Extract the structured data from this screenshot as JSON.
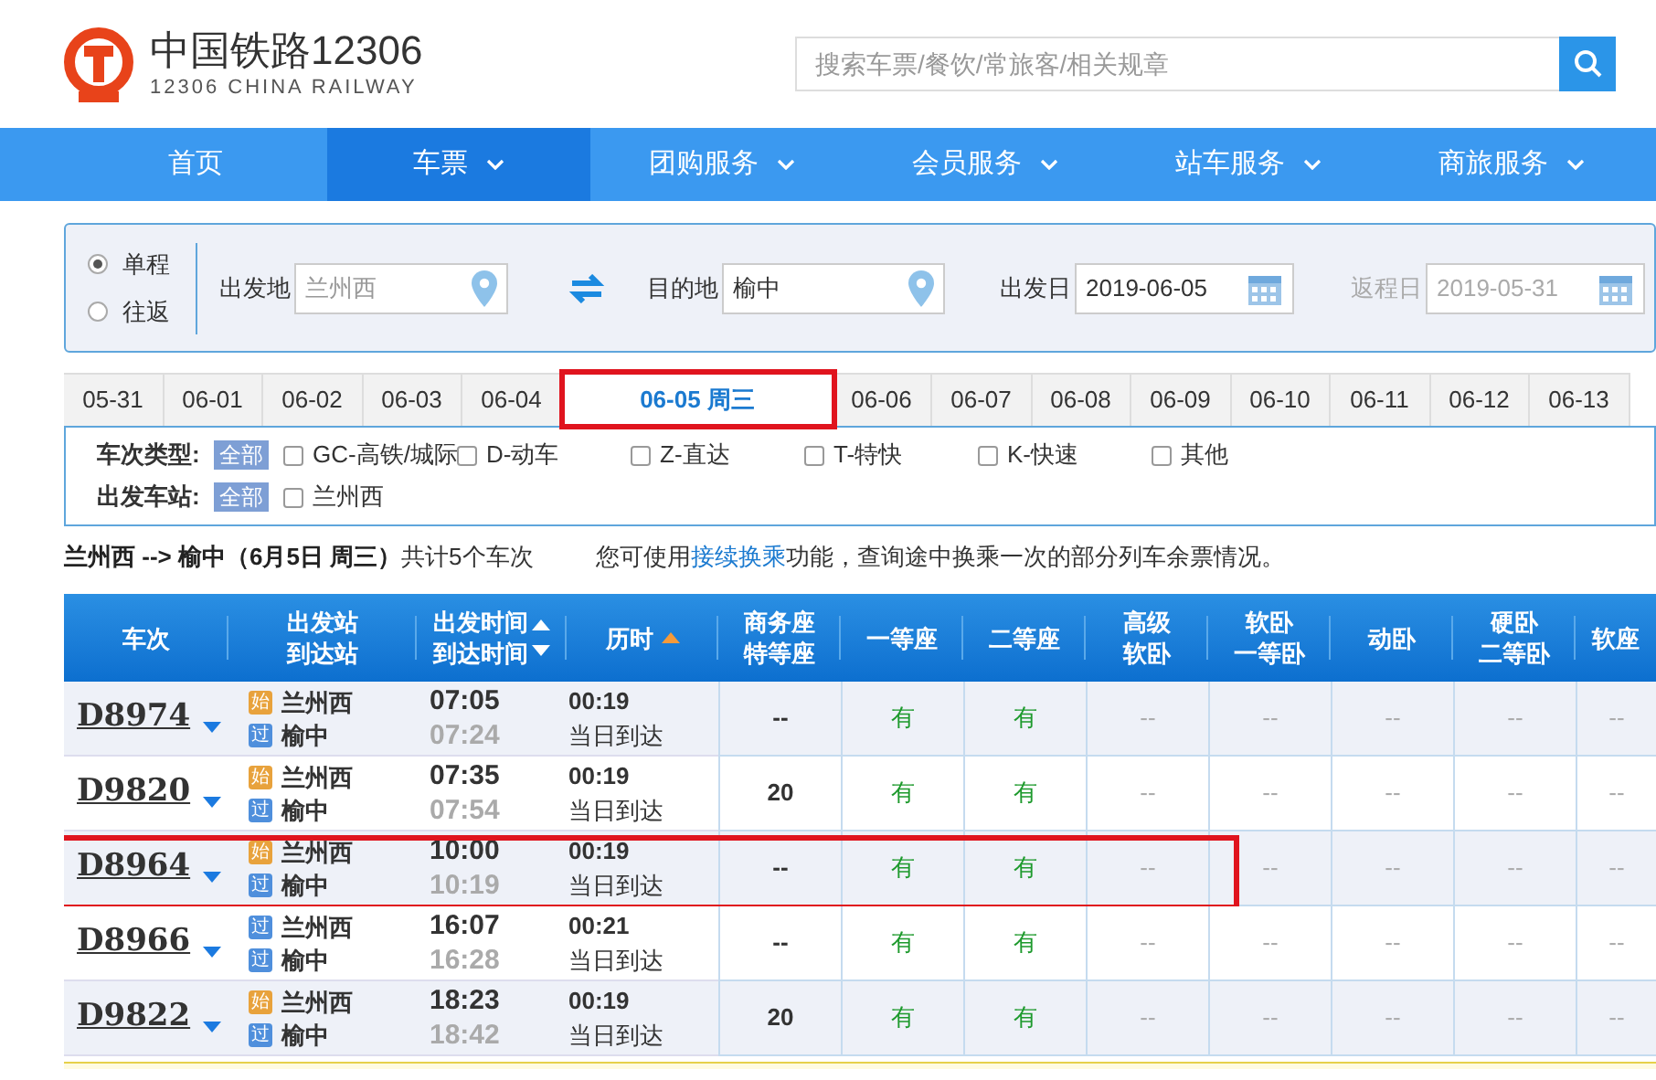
{
  "header": {
    "logo_title": "中国铁路12306",
    "logo_subtitle": "12306 CHINA RAILWAY",
    "search_placeholder": "搜索车票/餐饮/常旅客/相关规章"
  },
  "nav": [
    {
      "label": "首页",
      "selected": false,
      "dropdown": false
    },
    {
      "label": "车票",
      "selected": true,
      "dropdown": true
    },
    {
      "label": "团购服务",
      "selected": false,
      "dropdown": true
    },
    {
      "label": "会员服务",
      "selected": false,
      "dropdown": true
    },
    {
      "label": "站车服务",
      "selected": false,
      "dropdown": true
    },
    {
      "label": "商旅服务",
      "selected": false,
      "dropdown": true
    }
  ],
  "trip_type": [
    {
      "label": "单程",
      "selected": true
    },
    {
      "label": "往返",
      "selected": false
    }
  ],
  "query": {
    "from_label": "出发地",
    "from_value": "兰州西",
    "to_label": "目的地",
    "to_value": "榆中",
    "date_label": "出发日",
    "date_value": "2019-06-05",
    "return_label": "返程日",
    "return_value": "2019-05-31"
  },
  "date_tabs": [
    {
      "label": "05-31",
      "selected": false
    },
    {
      "label": "06-01",
      "selected": false
    },
    {
      "label": "06-02",
      "selected": false
    },
    {
      "label": "06-03",
      "selected": false
    },
    {
      "label": "06-04",
      "selected": false
    },
    {
      "label": "06-05 周三",
      "selected": true
    },
    {
      "label": "06-06",
      "selected": false
    },
    {
      "label": "06-07",
      "selected": false
    },
    {
      "label": "06-08",
      "selected": false
    },
    {
      "label": "06-09",
      "selected": false
    },
    {
      "label": "06-10",
      "selected": false
    },
    {
      "label": "06-11",
      "selected": false
    },
    {
      "label": "06-12",
      "selected": false
    },
    {
      "label": "06-13",
      "selected": false
    }
  ],
  "filters": [
    {
      "label": "车次类型:",
      "all": "全部",
      "options": [
        {
          "label": "GC-高铁/城际",
          "checked": false
        },
        {
          "label": "D-动车",
          "checked": false
        },
        {
          "label": "Z-直达",
          "checked": false
        },
        {
          "label": "T-特快",
          "checked": false
        },
        {
          "label": "K-快速",
          "checked": false
        },
        {
          "label": "其他",
          "checked": false
        }
      ]
    },
    {
      "label": "出发车站:",
      "all": "全部",
      "options": [
        {
          "label": "兰州西",
          "checked": false
        }
      ]
    }
  ],
  "summary": {
    "route": "兰州西 --> 榆中（6月5日  周三）",
    "count": "共计5个车次",
    "hint_before": "您可使用",
    "hint_link": "接续换乘",
    "hint_after": "功能，查询途中换乘一次的部分列车余票情况。"
  },
  "columns": [
    {
      "lines": [
        "车次"
      ],
      "kind": "plain"
    },
    {
      "lines": [
        "出发站",
        "到达站"
      ],
      "kind": "plain"
    },
    {
      "lines": [
        "出发时间",
        "到达时间"
      ],
      "kind": "sortable"
    },
    {
      "lines": [
        "历时"
      ],
      "kind": "sorted"
    },
    {
      "lines": [
        "商务座",
        "特等座"
      ],
      "kind": "plain"
    },
    {
      "lines": [
        "一等座"
      ],
      "kind": "plain"
    },
    {
      "lines": [
        "二等座"
      ],
      "kind": "plain"
    },
    {
      "lines": [
        "高级",
        "软卧"
      ],
      "kind": "plain"
    },
    {
      "lines": [
        "软卧",
        "一等卧"
      ],
      "kind": "plain"
    },
    {
      "lines": [
        "动卧"
      ],
      "kind": "plain"
    },
    {
      "lines": [
        "硬卧",
        "二等卧"
      ],
      "kind": "plain"
    },
    {
      "lines": [
        "软座"
      ],
      "kind": "plain"
    }
  ],
  "rows": [
    {
      "train": "D8974",
      "stations": [
        {
          "kind": "start",
          "badge": "始",
          "name": "兰州西"
        },
        {
          "kind": "pass",
          "badge": "过",
          "name": "榆中"
        }
      ],
      "depart": "07:05",
      "arrive": "07:24",
      "duration": "00:19",
      "arrival_day": "当日到达",
      "seats": [
        "--",
        "有",
        "有",
        "--",
        "--",
        "--",
        "--",
        "--"
      ],
      "highlighted": false
    },
    {
      "train": "D9820",
      "stations": [
        {
          "kind": "start",
          "badge": "始",
          "name": "兰州西"
        },
        {
          "kind": "pass",
          "badge": "过",
          "name": "榆中"
        }
      ],
      "depart": "07:35",
      "arrive": "07:54",
      "duration": "00:19",
      "arrival_day": "当日到达",
      "seats": [
        "20",
        "有",
        "有",
        "--",
        "--",
        "--",
        "--",
        "--"
      ],
      "highlighted": false
    },
    {
      "train": "D8964",
      "stations": [
        {
          "kind": "start",
          "badge": "始",
          "name": "兰州西"
        },
        {
          "kind": "pass",
          "badge": "过",
          "name": "榆中"
        }
      ],
      "depart": "10:00",
      "arrive": "10:19",
      "duration": "00:19",
      "arrival_day": "当日到达",
      "seats": [
        "--",
        "有",
        "有",
        "--",
        "--",
        "--",
        "--",
        "--"
      ],
      "highlighted": true
    },
    {
      "train": "D8966",
      "stations": [
        {
          "kind": "pass",
          "badge": "过",
          "name": "兰州西"
        },
        {
          "kind": "pass",
          "badge": "过",
          "name": "榆中"
        }
      ],
      "depart": "16:07",
      "arrive": "16:28",
      "duration": "00:21",
      "arrival_day": "当日到达",
      "seats": [
        "--",
        "有",
        "有",
        "--",
        "--",
        "--",
        "--",
        "--"
      ],
      "highlighted": false
    },
    {
      "train": "D9822",
      "stations": [
        {
          "kind": "start",
          "badge": "始",
          "name": "兰州西"
        },
        {
          "kind": "pass",
          "badge": "过",
          "name": "榆中"
        }
      ],
      "depart": "18:23",
      "arrive": "18:42",
      "duration": "00:19",
      "arrival_day": "当日到达",
      "seats": [
        "20",
        "有",
        "有",
        "--",
        "--",
        "--",
        "--",
        "--"
      ],
      "highlighted": false
    }
  ]
}
